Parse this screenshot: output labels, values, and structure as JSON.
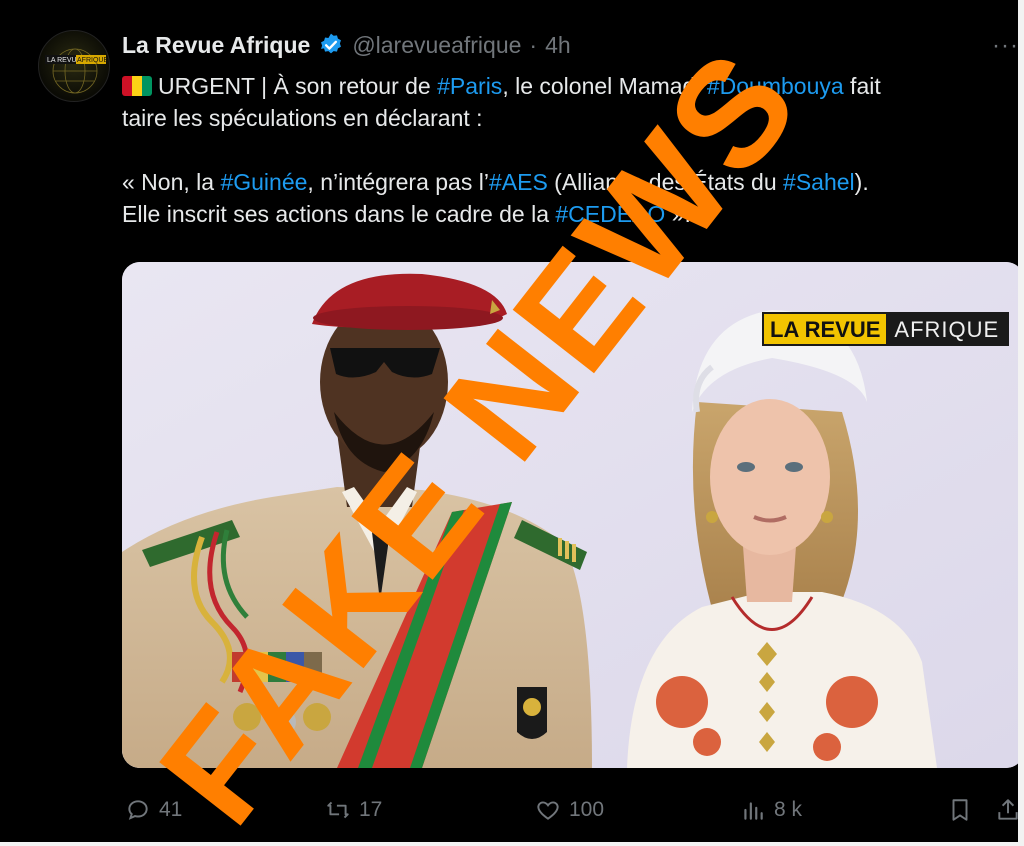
{
  "tweet": {
    "avatar_text": "LA REVUE AFRIQUE",
    "author_name": "La Revue Afrique",
    "handle": "@larevueafrique",
    "separator": "·",
    "time": "4h",
    "more_label": "···",
    "line1_prefix": "URGENT | À son retour de ",
    "tag_paris": "#Paris",
    "line1_mid": ", le colonel Mamadi ",
    "tag_doumbouya": "#Doumbouya",
    "line1_suffix": " fait",
    "line2": "taire les spéculations en déclarant :",
    "line3_prefix": "« Non, la ",
    "tag_guinee": "#Guinée",
    "line3_mid": ", n’intégrera pas l’",
    "tag_aes": "#AES",
    "line3_mid2": " (Alliance des États du ",
    "tag_sahel": "#Sahel",
    "line3_suffix": ").",
    "line4_prefix": "Elle inscrit ses actions dans le cadre de la ",
    "tag_cedeao": "#CEDEAO",
    "line4_suffix": " ».",
    "flag_colors": [
      "#ce1126",
      "#fcd116",
      "#009460"
    ]
  },
  "media": {
    "brand_part1": "LA REVUE",
    "brand_part2": "AFRIQUE"
  },
  "actions": {
    "replies": "41",
    "reposts": "17",
    "likes": "100",
    "views": "8 k"
  },
  "overlay": {
    "stamp_text": "FAKE NEWS",
    "stamp_color": "#ff7f00"
  },
  "colors": {
    "background": "#000000",
    "text": "#e7e9ea",
    "muted": "#71767b",
    "link": "#1d9bf0",
    "verified": "#1d9bf0"
  }
}
